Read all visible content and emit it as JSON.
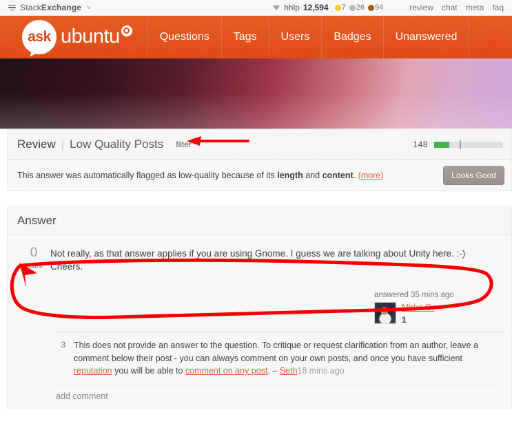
{
  "se_bar": {
    "menu_icon": "stack-lines-icon",
    "network_name_plain": "Stack",
    "network_name_bold": "Exchange",
    "chevron": "˅",
    "inbox_icon": "inbox-caret-icon",
    "username": "hhlp",
    "reputation": "12,594",
    "badges": [
      {
        "type": "gold",
        "count": "7"
      },
      {
        "type": "silver",
        "count": "26"
      },
      {
        "type": "bronze",
        "count": "94"
      }
    ],
    "links": [
      "review",
      "chat",
      "meta",
      "faq"
    ]
  },
  "nav": {
    "logo_bubble_text": "ask",
    "logo_wordmark": "ubuntu",
    "logo_mark_icon": "ubuntu-circle-of-friends-icon",
    "tabs": [
      "Questions",
      "Tags",
      "Users",
      "Badges",
      "Unanswered"
    ],
    "brand_color": "#dd4814"
  },
  "review": {
    "title": "Review",
    "divider": "|",
    "subtitle": "Low Quality Posts",
    "filter_label": "filter",
    "remaining_count": "148",
    "progress_fill_percent": 22,
    "progress_tick_percent": 37,
    "progress_color": "#48b14c"
  },
  "flag_notice": {
    "text_part1": "This answer was automatically flagged as low-quality because of its ",
    "bold1": "length",
    "text_part2": " and ",
    "bold2": "content",
    "text_part3": ". ",
    "more_link": "(more)",
    "button_label": "Looks Good",
    "link_color": "#e8613c"
  },
  "answer_section": {
    "header": "Answer",
    "vote_count": "0",
    "vote_label": "votes",
    "body_line1": "Not really, as that answer applies if you are using Gnome. I guess we are talking about Unity here. :-)",
    "body_line2": "Cheers.",
    "user_card": {
      "action_time": "answered 35 mins ago",
      "avatar_icon": "user-avatar",
      "display_name": "Mirko G.",
      "reputation": "1"
    }
  },
  "comments": {
    "items": [
      {
        "score": "3",
        "text_part1": "This does not provide an answer to the question. To critique or request clarification from an author, leave a comment below their post - you can always comment on your own posts, and once you have sufficient ",
        "link1": "reputation",
        "text_part2": " you will be able to ",
        "link2": "comment on any post",
        "text_part3": ". ",
        "dash": "– ",
        "author": "Seth",
        "time": "18 mins ago"
      }
    ],
    "add_comment_label": "add comment"
  },
  "annotations": {
    "color": "#f50000",
    "arrow_to_filter": "red-arrow-pointing-at-filter-link",
    "circle_around_answer": "red-hand-drawn-ellipse-around-answer-body"
  }
}
